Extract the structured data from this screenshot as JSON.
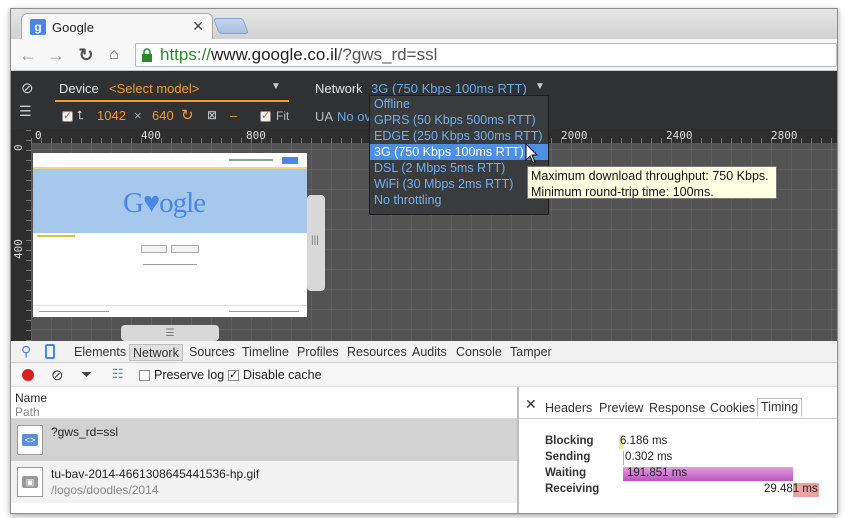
{
  "browser": {
    "tab_title": "Google",
    "tab_favicon": "google-favicon",
    "url_scheme": "https://",
    "url_host": "www.google.co.il",
    "url_path": "/?gws_rd=ssl"
  },
  "emulation": {
    "device_label": "Device",
    "device_select": "<Select model>",
    "width": "1042",
    "times": "×",
    "height": "640",
    "dash": "–",
    "fit_label": "Fit",
    "network_label": "Network",
    "network_select": "3G (750 Kbps 100ms RTT)",
    "ua_label": "UA",
    "ua_value_partial": "No ov",
    "options": [
      "Offline",
      "GPRS (50 Kbps 500ms RTT)",
      "EDGE (250 Kbps 300ms RTT)",
      "3G (750 Kbps 100ms RTT)",
      "DSL (2 Mbps 5ms RTT)",
      "WiFi (30 Mbps 2ms RTT)",
      "No throttling"
    ],
    "selected_index": 3,
    "tooltip_line1": "Maximum download throughput: 750 Kbps.",
    "tooltip_line2": "Minimum round-trip time: 100ms."
  },
  "rulers": {
    "top": [
      "0",
      "400",
      "800",
      "2000",
      "2400",
      "2800"
    ],
    "left": [
      "0",
      "400"
    ]
  },
  "preview": {
    "logo_text": "Google"
  },
  "devtools": {
    "tabs": [
      "Elements",
      "Network",
      "Sources",
      "Timeline",
      "Profiles",
      "Resources",
      "Audits",
      "Console",
      "Tamper"
    ],
    "active_tab": "Network",
    "preserve_log": "Preserve log",
    "disable_cache": "Disable cache",
    "col_name": "Name",
    "col_path": "Path",
    "requests": [
      {
        "name": "?gws_rd=ssl",
        "path": ""
      },
      {
        "name": "tu-bav-2014-4661308645441536-hp.gif",
        "path": "/logos/doodles/2014"
      }
    ],
    "detail_tabs": [
      "Headers",
      "Preview",
      "Response",
      "Cookies",
      "Timing"
    ],
    "detail_active": "Timing",
    "timing": [
      {
        "label": "Blocking",
        "value": "6.186 ms",
        "color": "#e8e8a0"
      },
      {
        "label": "Sending",
        "value": "0.302 ms",
        "color": "#b0b0b0"
      },
      {
        "label": "Waiting",
        "value": "191.851 ms",
        "color": "#cc66cc"
      },
      {
        "label": "Receiving",
        "value": "29.481 ms",
        "color": "#e9a3a3"
      }
    ]
  }
}
